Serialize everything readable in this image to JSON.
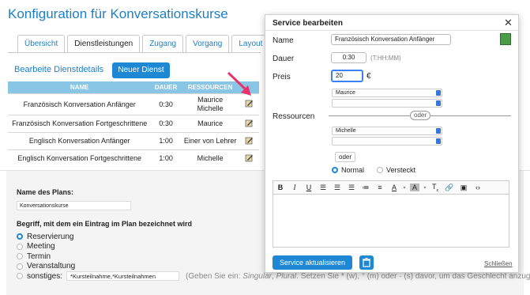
{
  "page": {
    "title": "Konfiguration für Konversationskurse"
  },
  "tabs": [
    {
      "label": "Übersicht"
    },
    {
      "label": "Dienstleistungen"
    },
    {
      "label": "Zugang"
    },
    {
      "label": "Vorgang"
    },
    {
      "label": "Layout"
    }
  ],
  "services": {
    "edit_link": "Bearbeite Dienstdetails",
    "new_button": "Neuer Dienst",
    "columns": [
      "NAME",
      "DAUER",
      "RESSOURCEN"
    ],
    "rows": [
      {
        "name": "Französisch Konversation Anfänger",
        "duration": "0:30",
        "resources": "Maurice\nMichelle"
      },
      {
        "name": "Französisch Konversation Fortgeschrittene",
        "duration": "0:30",
        "resources": "Maurice"
      },
      {
        "name": "Englisch Konversation Anfänger",
        "duration": "1:00",
        "resources": "Einer von Lehrer"
      },
      {
        "name": "Englisch Konversation Fortgeschrittene",
        "duration": "1:00",
        "resources": "Michelle"
      }
    ]
  },
  "plan": {
    "name_label": "Name des Plans:",
    "name_value": "Konversationskurse",
    "term_label": "Begriff, mit dem ein Eintrag im Plan bezeichnet wird",
    "options": [
      "Reservierung",
      "Meeting",
      "Termin",
      "Veranstaltung",
      "sonstiges:"
    ],
    "selected": "Reservierung",
    "other_value": "*Kursteilnahme,*Kursteilnahmen",
    "other_hint_pre": "(Geben Sie ein: ",
    "other_hint_singular": "Singular",
    "other_hint_mid": ", ",
    "other_hint_plural": "Plural",
    "other_hint_post": ". Setzen Sie * (w), ° (m) oder · (s) davor, um das Geschlecht anzugeben)"
  },
  "dialog": {
    "title": "Service bearbeiten",
    "name_label": "Name",
    "name_value": "Französisch Konversation Anfänger",
    "duration_label": "Dauer",
    "duration_value": "0:30",
    "duration_hint": "(T:HH:MM)",
    "price_label": "Preis",
    "price_value": "20",
    "currency": "€",
    "resources_label": "Ressourcen",
    "resource_select_1": "Maurice",
    "resource_select_2": "",
    "or_label_1": "oder",
    "resource_select_3": "Michelle",
    "resource_select_4": "",
    "or_button_2": "oder",
    "visibility_normal": "Normal",
    "visibility_hidden": "Versteckt",
    "visibility_selected": "Normal",
    "update_button": "Service aktualisieren",
    "close_link": "Schließen",
    "swatch_color": "#4a9d46"
  },
  "colors": {
    "accent": "#1e88d5",
    "title": "#1f7fc5",
    "table_header": "#89c6e6",
    "arrow": "#e8336f"
  }
}
